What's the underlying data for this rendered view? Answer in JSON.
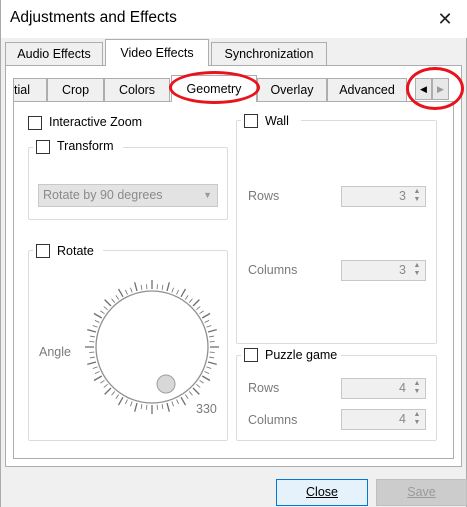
{
  "window": {
    "title": "Adjustments and Effects",
    "close_glyph": "✕"
  },
  "main_tabs": [
    {
      "label": "Audio Effects"
    },
    {
      "label": "Video Effects"
    },
    {
      "label": "Synchronization"
    }
  ],
  "video_tabs": [
    {
      "label": "tial"
    },
    {
      "label": "Crop"
    },
    {
      "label": "Colors"
    },
    {
      "label": "Geometry"
    },
    {
      "label": "Overlay"
    },
    {
      "label": "Advanced"
    }
  ],
  "tab_scroll": {
    "left": "◀",
    "right": "▶"
  },
  "geometry": {
    "interactive_zoom": {
      "label": "Interactive Zoom",
      "checked": false
    },
    "transform": {
      "label": "Transform",
      "checked": false,
      "combo_value": "Rotate by 90 degrees",
      "combo_arrow": "▼"
    },
    "rotate": {
      "label": "Rotate",
      "checked": false,
      "angle_label": "Angle",
      "angle_value": "330"
    },
    "wall": {
      "label": "Wall",
      "checked": false,
      "rows_label": "Rows",
      "rows_value": "3",
      "columns_label": "Columns",
      "columns_value": "3"
    },
    "puzzle": {
      "label": "Puzzle game",
      "checked": false,
      "rows_label": "Rows",
      "rows_value": "4",
      "columns_label": "Columns",
      "columns_value": "4"
    }
  },
  "spin_arrows": {
    "up": "▲",
    "down": "▼"
  },
  "buttons": {
    "close": "Close",
    "save": "Save"
  },
  "annotation_color": "#e8131b"
}
